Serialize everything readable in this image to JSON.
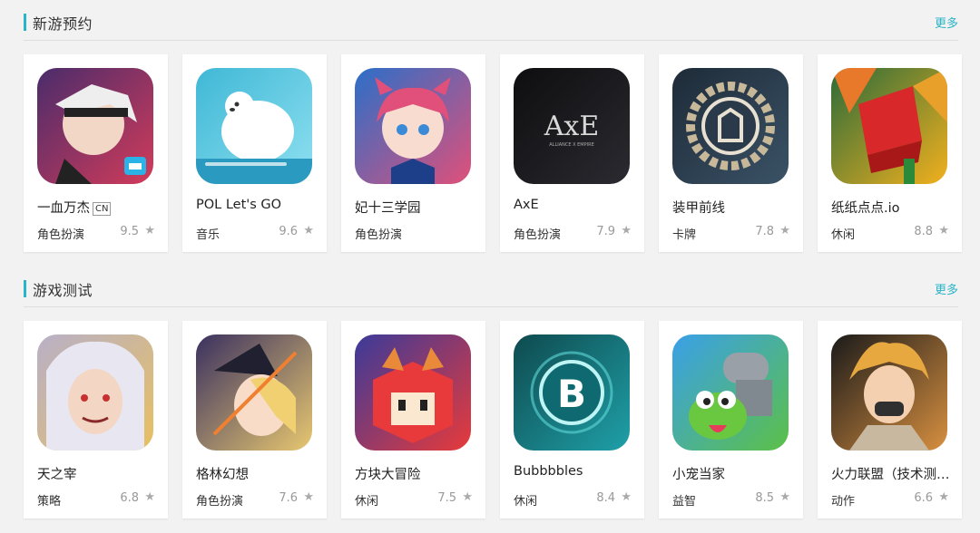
{
  "sections": [
    {
      "title": "新游预约",
      "more": "更多",
      "games": [
        {
          "name": "一血万杰",
          "badge": "CN",
          "category": "角色扮演",
          "rating": "9.5",
          "icon": "anime-warrior-icon",
          "colors": [
            "#4a2c6b",
            "#d23b5a"
          ]
        },
        {
          "name": "POL Let's GO",
          "badge": "",
          "category": "音乐",
          "rating": "9.6",
          "icon": "polar-bear-icon",
          "colors": [
            "#3fb8d6",
            "#8fe0f0"
          ]
        },
        {
          "name": "妃十三学园",
          "badge": "",
          "category": "角色扮演",
          "rating": "",
          "icon": "anime-girl-icon",
          "colors": [
            "#2a6fc9",
            "#e0507a"
          ]
        },
        {
          "name": "AxE",
          "badge": "",
          "category": "角色扮演",
          "rating": "7.9",
          "icon": "axe-logo-icon",
          "colors": [
            "#0e0e10",
            "#2a2a30"
          ]
        },
        {
          "name": "装甲前线",
          "badge": "",
          "category": "卡牌",
          "rating": "7.8",
          "icon": "armor-emblem-icon",
          "colors": [
            "#1e2b38",
            "#3a5266"
          ]
        },
        {
          "name": "纸纸点点.io",
          "badge": "",
          "category": "休闲",
          "rating": "8.8",
          "icon": "paper-cube-icon",
          "colors": [
            "#2a6b3a",
            "#f2b01e"
          ]
        }
      ]
    },
    {
      "title": "游戏测试",
      "more": "更多",
      "games": [
        {
          "name": "天之宰",
          "badge": "",
          "category": "策略",
          "rating": "6.8",
          "icon": "white-hair-hero-icon",
          "colors": [
            "#b8b0c8",
            "#e8c060"
          ]
        },
        {
          "name": "格林幻想",
          "badge": "",
          "category": "角色扮演",
          "rating": "7.6",
          "icon": "witch-icon",
          "colors": [
            "#3a3060",
            "#e8c870"
          ]
        },
        {
          "name": "方块大冒险",
          "badge": "",
          "category": "休闲",
          "rating": "7.5",
          "icon": "cube-fox-icon",
          "colors": [
            "#3a3a9a",
            "#e83a3a"
          ]
        },
        {
          "name": "Bubbbbles",
          "badge": "",
          "category": "休闲",
          "rating": "8.4",
          "icon": "bubble-b-icon",
          "colors": [
            "#0e4a4e",
            "#1fa0a8"
          ]
        },
        {
          "name": "小宠当家",
          "badge": "",
          "category": "益智",
          "rating": "8.5",
          "icon": "cannon-frog-icon",
          "colors": [
            "#3aa0e8",
            "#5cc048"
          ]
        },
        {
          "name": "火力联盟（技术测试）",
          "badge": "",
          "category": "动作",
          "rating": "6.6",
          "icon": "fire-girl-icon",
          "colors": [
            "#1a1a1a",
            "#d89040"
          ]
        }
      ]
    }
  ],
  "star_glyph": "★"
}
